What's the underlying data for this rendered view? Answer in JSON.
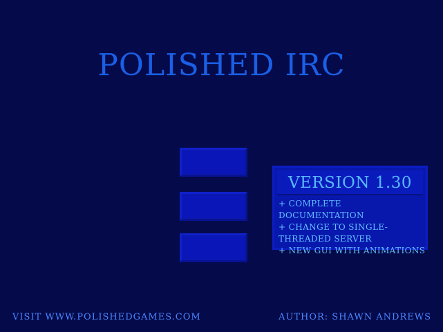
{
  "app": {
    "title": "Polished IRC"
  },
  "menu": {
    "buttons": [
      {
        "label": ""
      },
      {
        "label": ""
      },
      {
        "label": ""
      }
    ]
  },
  "version_panel": {
    "version": "Version 1.30",
    "changes": [
      "+ Complete documentation",
      "+ Change to single-threaded server",
      "+ New GUI with animations"
    ]
  },
  "footer": {
    "website": "Visit www.polishedgames.com",
    "author": "Author: Shawn Andrews"
  },
  "colors": {
    "background": "#050a4a",
    "title": "#1a5fe6",
    "button": "#0a16b8",
    "panel": "#0818ad",
    "panel_text": "#62bfff",
    "footer_text": "#4a86ff"
  }
}
